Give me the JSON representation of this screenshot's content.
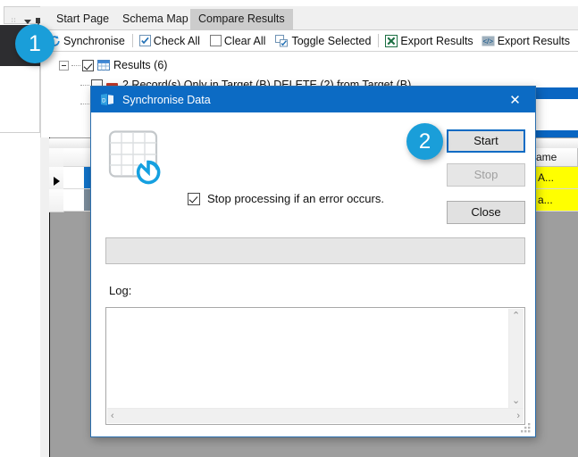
{
  "window": {
    "tabs": [
      {
        "label": "Start Page",
        "active": false
      },
      {
        "label": "Schema Map",
        "active": false
      },
      {
        "label": "Compare Results",
        "active": true
      }
    ],
    "toolbar": {
      "synchronise": "Synchronise",
      "check_all": "Check All",
      "clear_all": "Clear All",
      "toggle_selected": "Toggle Selected",
      "export_results_excel": "Export Results",
      "export_results_xml": "Export Results"
    },
    "tree": {
      "root_label": "Results (6)",
      "child_1": "2 Record(s) Only in Target (B) DELETE (2) from Target (B)",
      "child_2": ""
    },
    "grid": {
      "column_header": "ame",
      "cells": [
        "A...",
        "a..."
      ]
    }
  },
  "dialog": {
    "title": "Synchronise Data",
    "close_glyph": "✕",
    "checkbox_label": "Stop processing if an error occurs.",
    "checkbox_checked": true,
    "buttons": {
      "start": "Start",
      "stop": "Stop",
      "close": "Close"
    },
    "log_label": "Log:",
    "log_text": "",
    "progress_text": ""
  },
  "callouts": [
    {
      "number": "1"
    },
    {
      "number": "2"
    }
  ],
  "colors": {
    "accent_blue": "#0c6bc4",
    "badge_blue": "#1a9ed9",
    "highlight_yellow": "#ffff00",
    "selection_blue": "#0a66c2",
    "tab_active": "#cccccc"
  }
}
